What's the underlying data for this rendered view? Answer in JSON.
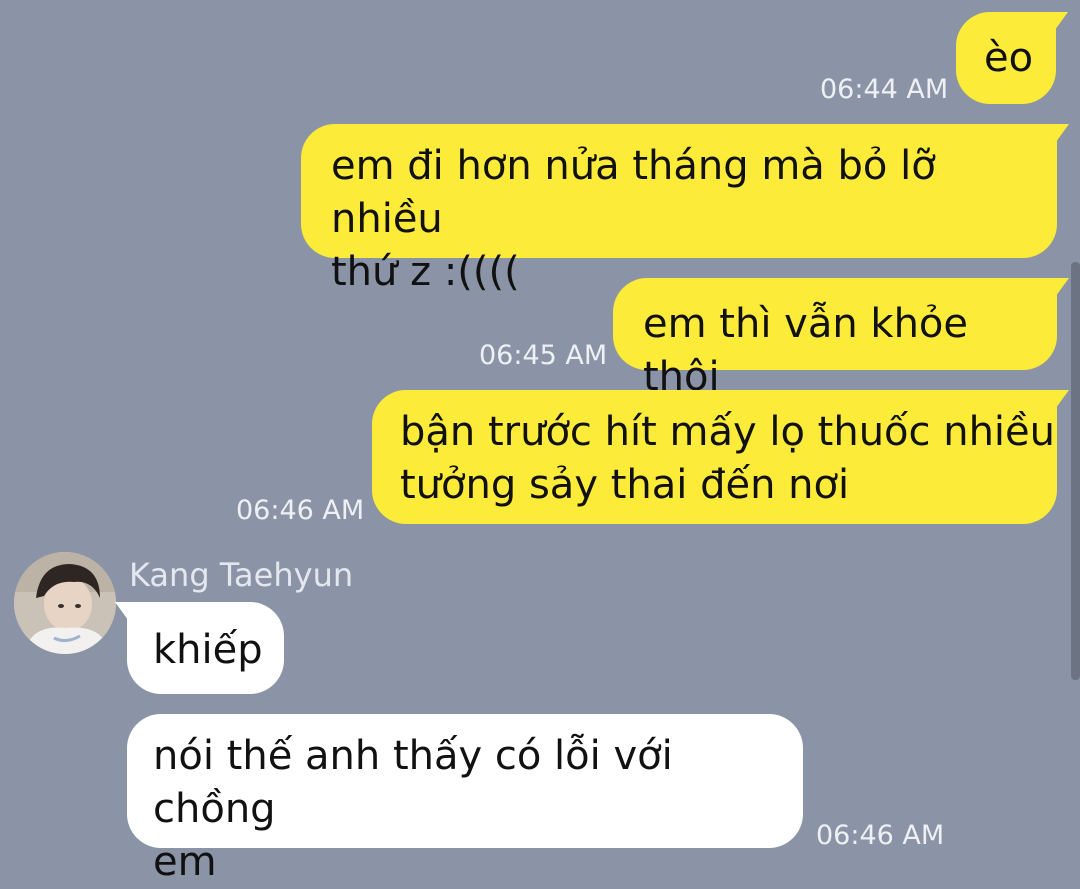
{
  "messages": [
    {
      "id": "m1",
      "direction": "outgoing",
      "text": "èo",
      "time": "06:44 AM"
    },
    {
      "id": "m2",
      "direction": "outgoing",
      "text": "em đi hơn nửa tháng mà bỏ lỡ nhiều\nthứ z :((((",
      "time": ""
    },
    {
      "id": "m3",
      "direction": "outgoing",
      "text": "em thì vẫn khỏe thôi",
      "time": "06:45 AM"
    },
    {
      "id": "m4",
      "direction": "outgoing",
      "text": "bận trước hít mấy lọ thuốc nhiều\ntưởng sảy thai đến nơi",
      "time": "06:46 AM"
    },
    {
      "id": "m5",
      "direction": "incoming",
      "text": "khiếp",
      "time": ""
    },
    {
      "id": "m6",
      "direction": "incoming",
      "text": "nói thế anh thấy có lỗi với chồng\nem",
      "time": "06:46 AM"
    }
  ],
  "contact": {
    "name": "Kang Taehyun",
    "avatar_icon": "profile-photo"
  },
  "colors": {
    "background": "#8a94a6",
    "outgoing_bubble": "#fdeb3a",
    "incoming_bubble": "#ffffff",
    "timestamp": "#eef0f4"
  }
}
